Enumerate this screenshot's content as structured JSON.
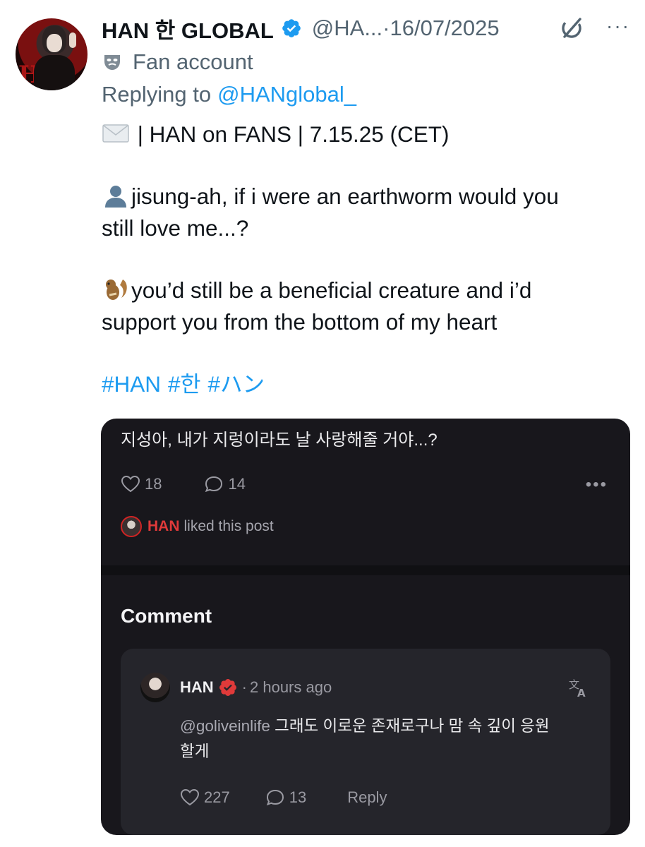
{
  "tweet": {
    "author_name": "HAN 한 GLOBAL",
    "handle": "@HA...",
    "date_sep": " · ",
    "date": "16/07/2025",
    "automated_label": "Fan account",
    "replying_prefix": "Replying to",
    "replying_handle": "@HANglobal_",
    "body": {
      "line1": " | HAN on FANS | 7.15.25 (CET)",
      "line2": "jisung-ah, if i were an earthworm would you",
      "line3": "still love me...?",
      "line4": "you’d still be a beneficial creature and i’d",
      "line5": "support you from the bottom of my heart"
    },
    "hashtags": [
      "#HAN",
      "#한",
      "#ハン"
    ],
    "icons": {
      "verified": "verified-badge-icon",
      "grok": "grok-icon",
      "more": "more-dots-icon",
      "label": "theater-mask-icon",
      "envelope": "envelope-emoji",
      "person": "bust-silhouette-emoji",
      "chipmunk": "chipmunk-emoji"
    },
    "colors": {
      "link": "#1d9bf0",
      "secondary": "#536471",
      "verified": "#1d9bf0"
    }
  },
  "media": {
    "post_text": "지성아, 내가 지렁이라도 날 사랑해줄 거야...?",
    "like_count": "18",
    "comment_count": "14",
    "liked_by_name": "HAN",
    "liked_by_suffix": "liked this post",
    "comment_heading": "Comment",
    "comment": {
      "author": "HAN",
      "time_sep": "·",
      "time": "2 hours ago",
      "mention": "@goliveinlife",
      "text_line1": " 그래도 이로운 존재로구나 맘 속 깊이 응원",
      "text_line2": "할게",
      "like_count": "227",
      "reply_count": "13",
      "reply_label": "Reply"
    },
    "colors": {
      "background": "#18171c",
      "card": "#25252b",
      "accent_red": "#e03a3a"
    }
  }
}
